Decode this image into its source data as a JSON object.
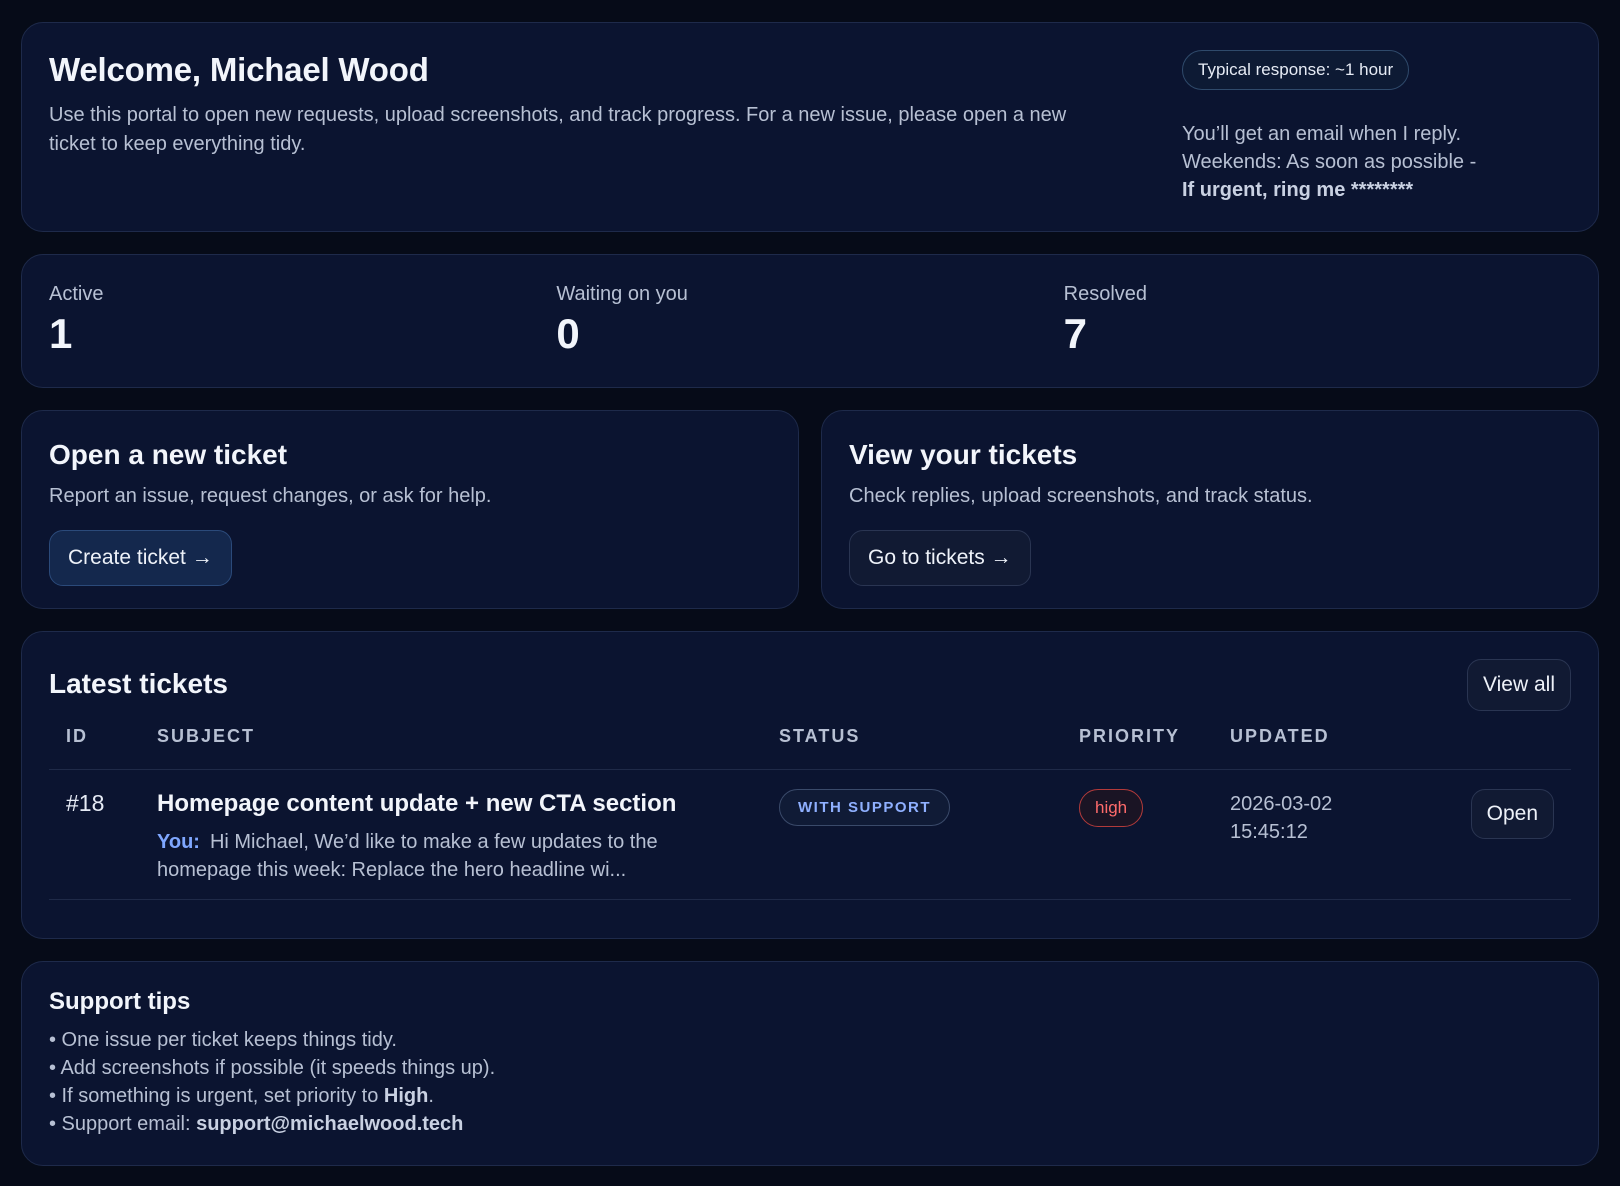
{
  "welcome": {
    "title": "Welcome, Michael Wood",
    "lead": "Use this portal to open new requests, upload screenshots, and track progress. For a new issue, please open a new ticket to keep everything tidy.",
    "response_pill": "Typical response: ~1 hour",
    "note_line1": "You’ll get an email when I reply.",
    "note_line2": "Weekends: As soon as possible -",
    "note_urgent": "If urgent, ring me ********"
  },
  "stats": [
    {
      "label": "Active",
      "value": "1"
    },
    {
      "label": "Waiting on you",
      "value": "0"
    },
    {
      "label": "Resolved",
      "value": "7"
    }
  ],
  "actions": {
    "new_ticket": {
      "title": "Open a new ticket",
      "desc": "Report an issue, request changes, or ask for help.",
      "button": "Create ticket →"
    },
    "view_tickets": {
      "title": "View your tickets",
      "desc": "Check replies, upload screenshots, and track status.",
      "button": "Go to tickets →"
    }
  },
  "latest": {
    "title": "Latest tickets",
    "view_all": "View all",
    "columns": [
      "ID",
      "SUBJECT",
      "STATUS",
      "PRIORITY",
      "UPDATED"
    ],
    "rows": [
      {
        "id": "#18",
        "subject": "Homepage content update + new CTA section",
        "preview_author": "You:",
        "preview": "Hi Michael, We’d like to make a few updates to the homepage this week: Replace the hero headline wi...",
        "status": "WITH SUPPORT",
        "priority": "high",
        "updated_date": "2026-03-02",
        "updated_time": "15:45:12",
        "action": "Open"
      }
    ]
  },
  "tips": {
    "title": "Support tips",
    "item1": "• One issue per ticket keeps things tidy.",
    "item2": "• Add screenshots if possible (it speeds things up).",
    "item3_pre": "• If something is urgent, set priority to ",
    "item3_bold": "High",
    "item3_post": ".",
    "item4_pre": "• Support email: ",
    "item4_bold": "support@michaelwood.tech"
  },
  "colors": {
    "background": "#060b18",
    "card": "#0b1430",
    "accent_blue": "#7fa7ff",
    "priority_high": "#ff6b6b"
  }
}
